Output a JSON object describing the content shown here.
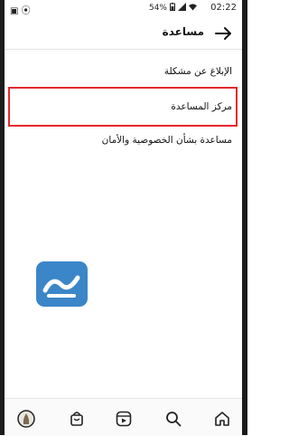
{
  "status_bar": {
    "time": "02:22",
    "battery": "54%"
  },
  "header": {
    "title": "مساعدة"
  },
  "menu": {
    "items": [
      {
        "label": "الإبلاغ عن مشكلة"
      },
      {
        "label": "مركز المساعدة"
      },
      {
        "label": "مساعدة بشأن الخصوصية والأمان"
      }
    ]
  },
  "colors": {
    "highlight": "#e3282c",
    "watermark": "#3b86c8"
  },
  "icons": {
    "back": "arrow-right-icon",
    "nav": [
      "profile-avatar-icon",
      "shop-bag-icon",
      "reels-icon",
      "search-icon",
      "home-icon"
    ]
  }
}
